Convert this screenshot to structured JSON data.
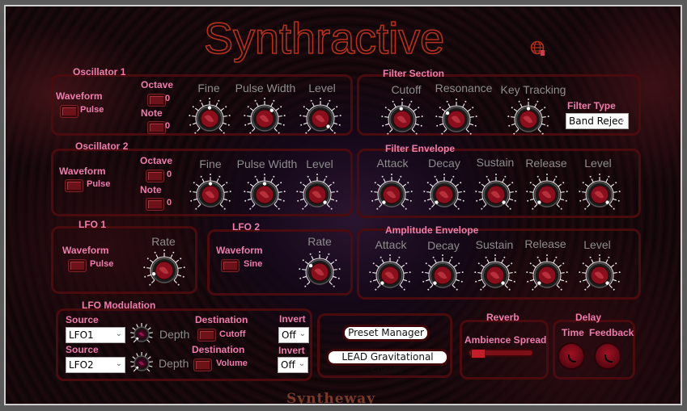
{
  "app": {
    "title": "Synthractive",
    "footer_brand": "Syntheway",
    "globe_icon": "globe-icon"
  },
  "colors": {
    "label_pink": "#ee7bad",
    "panel_border": "#4a0b0e",
    "title_stroke": "#b3301c",
    "knob_label_gray": "#8d8d8d"
  },
  "oscillator1": {
    "label": "Oscillator 1",
    "waveform_label": "Waveform",
    "waveform_value": "Pulse",
    "octave_label": "Octave",
    "octave_value": "0",
    "note_label": "Note",
    "note_value": "0",
    "knobs": [
      {
        "label": "Fine",
        "value": 0.5
      },
      {
        "label": "Pulse Width",
        "value": 0.65
      },
      {
        "label": "Level",
        "value": 1.0
      }
    ]
  },
  "oscillator2": {
    "label": "Oscillator 2",
    "waveform_label": "Waveform",
    "waveform_value": "Pulse",
    "octave_label": "Octave",
    "octave_value": "0",
    "note_label": "Note",
    "note_value": "0",
    "knobs": [
      {
        "label": "Fine",
        "value": 0.5
      },
      {
        "label": "Pulse Width",
        "value": 0.5
      },
      {
        "label": "Level",
        "value": 1.0
      }
    ]
  },
  "filter": {
    "label": "Filter Section",
    "knobs": [
      {
        "label": "Cutoff",
        "value": 0.48
      },
      {
        "label": "Resonance",
        "value": 0.3
      },
      {
        "label": "Key Tracking",
        "value": 0.5
      }
    ],
    "filter_type_label": "Filter Type",
    "filter_type_value": "Band Rejec"
  },
  "filter_envelope": {
    "label": "Filter Envelope",
    "knobs": [
      {
        "label": "Attack",
        "value": 0.0
      },
      {
        "label": "Decay",
        "value": 0.0
      },
      {
        "label": "Sustain",
        "value": 1.0
      },
      {
        "label": "Release",
        "value": 0.0
      },
      {
        "label": "Level",
        "value": 1.0
      }
    ]
  },
  "amp_envelope": {
    "label": "Amplitude Envelope",
    "knobs": [
      {
        "label": "Attack",
        "value": 0.0
      },
      {
        "label": "Decay",
        "value": 0.0
      },
      {
        "label": "Sustain",
        "value": 1.0
      },
      {
        "label": "Release",
        "value": 0.0
      },
      {
        "label": "Level",
        "value": 1.0
      }
    ]
  },
  "lfo1": {
    "label": "LFO 1",
    "waveform_label": "Waveform",
    "waveform_value": "Pulse",
    "rate_label": "Rate",
    "rate_value": 0.1
  },
  "lfo2": {
    "label": "LFO 2",
    "waveform_label": "Waveform",
    "waveform_value": "Sine",
    "rate_label": "Rate",
    "rate_value": 0.3
  },
  "lfo_mod": {
    "label": "LFO Modulation",
    "rows": [
      {
        "source_label": "Source",
        "source_value": "LFO1",
        "depth_label": "Depth",
        "depth_value": 0.0,
        "dest_label": "Destination",
        "dest_value": "Cutoff",
        "invert_label": "Invert",
        "invert_value": "Off"
      },
      {
        "source_label": "Source",
        "source_value": "LFO2",
        "depth_label": "Depth",
        "depth_value": 0.0,
        "dest_label": "Destination",
        "dest_value": "Volume",
        "invert_label": "Invert",
        "invert_value": "Off"
      }
    ]
  },
  "presets": {
    "manager_label": "Preset Manager",
    "current_preset": "LEAD Gravitational Energy"
  },
  "reverb": {
    "label": "Reverb",
    "slider_label": "Ambience Spread",
    "slider_value": 0.0
  },
  "delay": {
    "label": "Delay",
    "time_label": "Time",
    "feedback_label": "Feedback"
  }
}
